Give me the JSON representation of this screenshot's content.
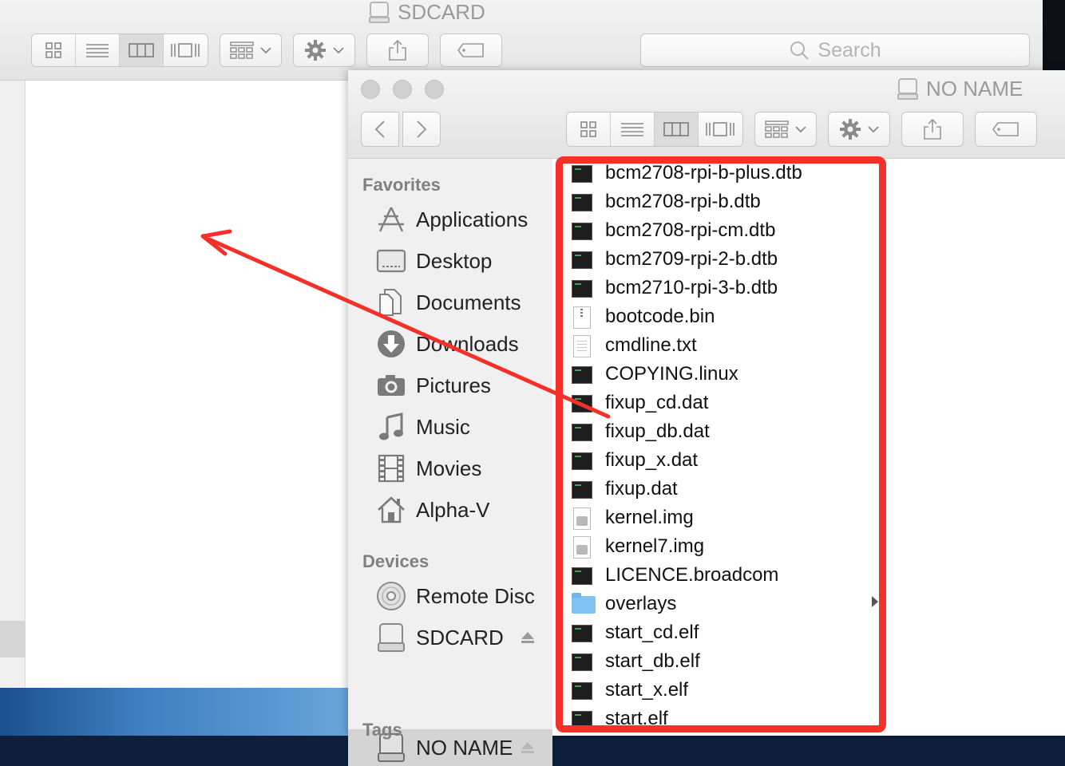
{
  "back_window": {
    "title": "SDCARD",
    "search_placeholder": "Search"
  },
  "front_window": {
    "title": "NO NAME"
  },
  "sidebar": {
    "favorites_heading": "Favorites",
    "favorites": [
      {
        "label": "Applications",
        "icon": "applications-icon"
      },
      {
        "label": "Desktop",
        "icon": "desktop-icon"
      },
      {
        "label": "Documents",
        "icon": "documents-icon"
      },
      {
        "label": "Downloads",
        "icon": "downloads-icon"
      },
      {
        "label": "Pictures",
        "icon": "camera-icon"
      },
      {
        "label": "Music",
        "icon": "music-note-icon"
      },
      {
        "label": "Movies",
        "icon": "film-icon"
      },
      {
        "label": "Alpha-V",
        "icon": "home-icon"
      }
    ],
    "devices_heading": "Devices",
    "devices": [
      {
        "label": "Remote Disc",
        "icon": "disc-icon"
      },
      {
        "label": "SDCARD",
        "icon": "drive-icon",
        "eject": true
      },
      {
        "label": "NO NAME",
        "icon": "drive-icon",
        "eject": true,
        "selected": true
      }
    ],
    "tags_heading": "Tags"
  },
  "files": [
    {
      "name": "bcm2708-rpi-b-plus.dtb",
      "kind": "exec"
    },
    {
      "name": "bcm2708-rpi-b.dtb",
      "kind": "exec"
    },
    {
      "name": "bcm2708-rpi-cm.dtb",
      "kind": "exec"
    },
    {
      "name": "bcm2709-rpi-2-b.dtb",
      "kind": "exec"
    },
    {
      "name": "bcm2710-rpi-3-b.dtb",
      "kind": "exec"
    },
    {
      "name": "bootcode.bin",
      "kind": "archive"
    },
    {
      "name": "cmdline.txt",
      "kind": "text"
    },
    {
      "name": "COPYING.linux",
      "kind": "exec"
    },
    {
      "name": "fixup_cd.dat",
      "kind": "exec"
    },
    {
      "name": "fixup_db.dat",
      "kind": "exec"
    },
    {
      "name": "fixup_x.dat",
      "kind": "exec"
    },
    {
      "name": "fixup.dat",
      "kind": "exec"
    },
    {
      "name": "kernel.img",
      "kind": "image"
    },
    {
      "name": "kernel7.img",
      "kind": "image"
    },
    {
      "name": "LICENCE.broadcom",
      "kind": "exec"
    },
    {
      "name": "overlays",
      "kind": "folder"
    },
    {
      "name": "start_cd.elf",
      "kind": "exec"
    },
    {
      "name": "start_db.elf",
      "kind": "exec"
    },
    {
      "name": "start_x.elf",
      "kind": "exec"
    },
    {
      "name": "start.elf",
      "kind": "exec"
    }
  ],
  "colors": {
    "annotation": "#f43028",
    "folder": "#7fc3f2",
    "sidebar_bg": "#f0f0f0"
  }
}
